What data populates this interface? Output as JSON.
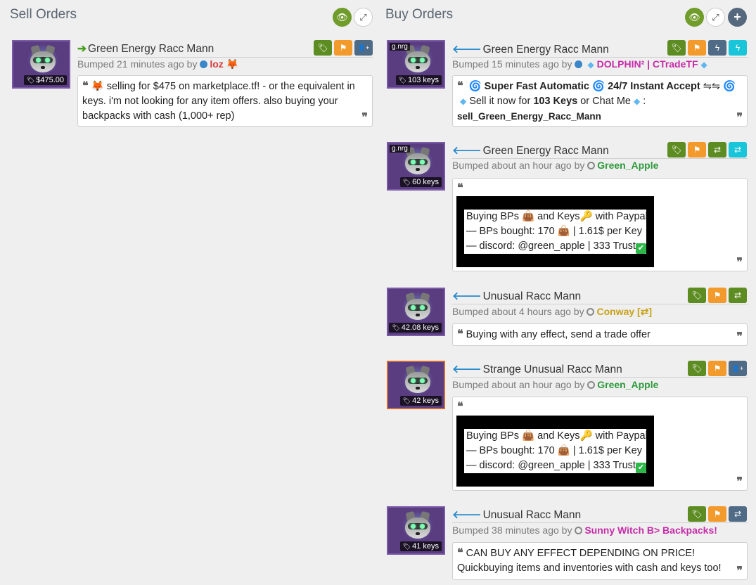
{
  "sell": {
    "title": "Sell Orders",
    "listings": [
      {
        "name": "Green Energy Racc Mann",
        "price": "$475.00",
        "bumped": "Bumped 21 minutes ago by",
        "user": "loz",
        "user_emoji": "🦊",
        "desc_emoji": "🦊",
        "desc": "selling for $475 on marketplace.tf! - or the equivalent in keys. i'm not looking for any item offers. also buying your backpacks with cash (1,000+ rep)"
      }
    ]
  },
  "buy": {
    "title": "Buy Orders",
    "listings": [
      {
        "name": "Green Energy Racc Mann",
        "quality": "g.nrg",
        "price": "103 keys",
        "bumped": "Bumped 15 minutes ago by",
        "user": "DOLPHIN² | CTradeTF",
        "desc_parts": {
          "a": "Super Fast Automatic",
          "b": "24/7 Instant Accept",
          "arrows": "⇋⇋",
          "c": "Sell it now for",
          "d": "103 Keys",
          "e": "or Chat Me",
          "colon": ":",
          "f": "sell_Green_Energy_Racc_Mann"
        }
      },
      {
        "name": "Green Energy Racc Mann",
        "quality": "g.nrg",
        "price": "60 keys",
        "bumped": "Bumped about an hour ago by",
        "user": "Green_Apple",
        "lines": {
          "l1a": "Buying BPs",
          "l1b": "and Keys",
          "l1c": "with Paypal",
          "l2a": "— BPs bought: 170",
          "l2b": "| 1.61$ per Key",
          "l3": "— discord: @green_apple | 333 Trust"
        }
      },
      {
        "name": "Unusual Racc Mann",
        "price": "42.08 keys",
        "bumped": "Bumped about 4 hours ago by",
        "user": "Conway [⇄]",
        "desc": "Buying with any effect, send a trade offer"
      },
      {
        "name": "Strange Unusual Racc Mann",
        "price": "42 keys",
        "bumped": "Bumped about an hour ago by",
        "user": "Green_Apple",
        "lines": {
          "l1a": "Buying BPs",
          "l1b": "and Keys",
          "l1c": "with Paypal",
          "l2a": "— BPs bought: 170",
          "l2b": "| 1.61$ per Key",
          "l3": "— discord: @green_apple | 333 Trust"
        }
      },
      {
        "name": "Unusual Racc Mann",
        "price": "41 keys",
        "bumped": "Bumped 38 minutes ago by",
        "user": "Sunny Witch B> Backpacks!",
        "desc": "CAN BUY ANY EFFECT DEPENDING ON PRICE! Quickbuying items and inventories with cash and keys too!"
      }
    ]
  },
  "icons": {
    "eye": "👁",
    "expand": "⤢",
    "plus": "+",
    "tag": "🏷",
    "flag": "⚑",
    "add_user": "👤+",
    "lightning": "ϟ",
    "swap": "⇄",
    "quote_open": "❝",
    "quote_close": "❞",
    "arrow_right": "➔",
    "arrow_left": "🡐",
    "swirl": "🌀",
    "diamond": "◆",
    "bag": "👜",
    "key": "🔑",
    "check": "✔"
  },
  "colors": {
    "green_btn": "#5d8c22",
    "orange_btn": "#f39a2c",
    "slate_btn": "#4f6b86",
    "cyan_btn": "#19c5d9",
    "unusual_bg": "#5a3d81",
    "strange_border": "#cf6a32"
  }
}
